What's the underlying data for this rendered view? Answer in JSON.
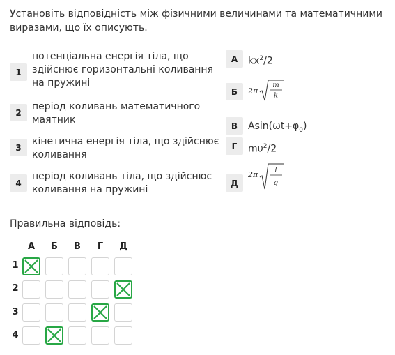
{
  "question": "Установіть відповідність між фізичними величинами та математичними виразами, що їх описують.",
  "left_items": [
    {
      "num": "1",
      "text": "потенціальна енергія тіла, що здійснює горизонтальні коливання на пружині"
    },
    {
      "num": "2",
      "text": "період коливань математичного маятник"
    },
    {
      "num": "3",
      "text": "кінетична енергія тіла, що здійснює коливання"
    },
    {
      "num": "4",
      "text": "період коливань тіла, що здійснює коливання на пружині"
    }
  ],
  "right_items": [
    {
      "letter": "А",
      "formula": "kx²/2"
    },
    {
      "letter": "Б",
      "formula": "2π√(m/k)"
    },
    {
      "letter": "В",
      "formula": "Asin(ωt+φ0)"
    },
    {
      "letter": "Г",
      "formula": "mυ²/2"
    },
    {
      "letter": "Д",
      "formula": "2π√(l/g)"
    }
  ],
  "formula_parts": {
    "A": {
      "base": "kx",
      "sup": "2",
      "tail": "/2"
    },
    "B": {
      "coef": "2π",
      "num": "m",
      "den": "k"
    },
    "V": {
      "main": "Asin(ωt+φ",
      "sub": "0",
      "tail": ")"
    },
    "G": {
      "base": "mυ",
      "sup": "2",
      "tail": "/2"
    },
    "D": {
      "coef": "2π",
      "num": "l",
      "den": "g"
    }
  },
  "answer_title": "Правильна відповідь:",
  "answer_grid": {
    "columns": [
      "А",
      "Б",
      "В",
      "Г",
      "Д"
    ],
    "rows": [
      "1",
      "2",
      "3",
      "4"
    ],
    "checked": [
      [
        true,
        false,
        false,
        false,
        false
      ],
      [
        false,
        false,
        false,
        false,
        true
      ],
      [
        false,
        false,
        false,
        true,
        false
      ],
      [
        false,
        true,
        false,
        false,
        false
      ]
    ]
  },
  "colors": {
    "check": "#28a745",
    "badge_bg": "#ececec",
    "cell_border": "#d4d4d4"
  }
}
